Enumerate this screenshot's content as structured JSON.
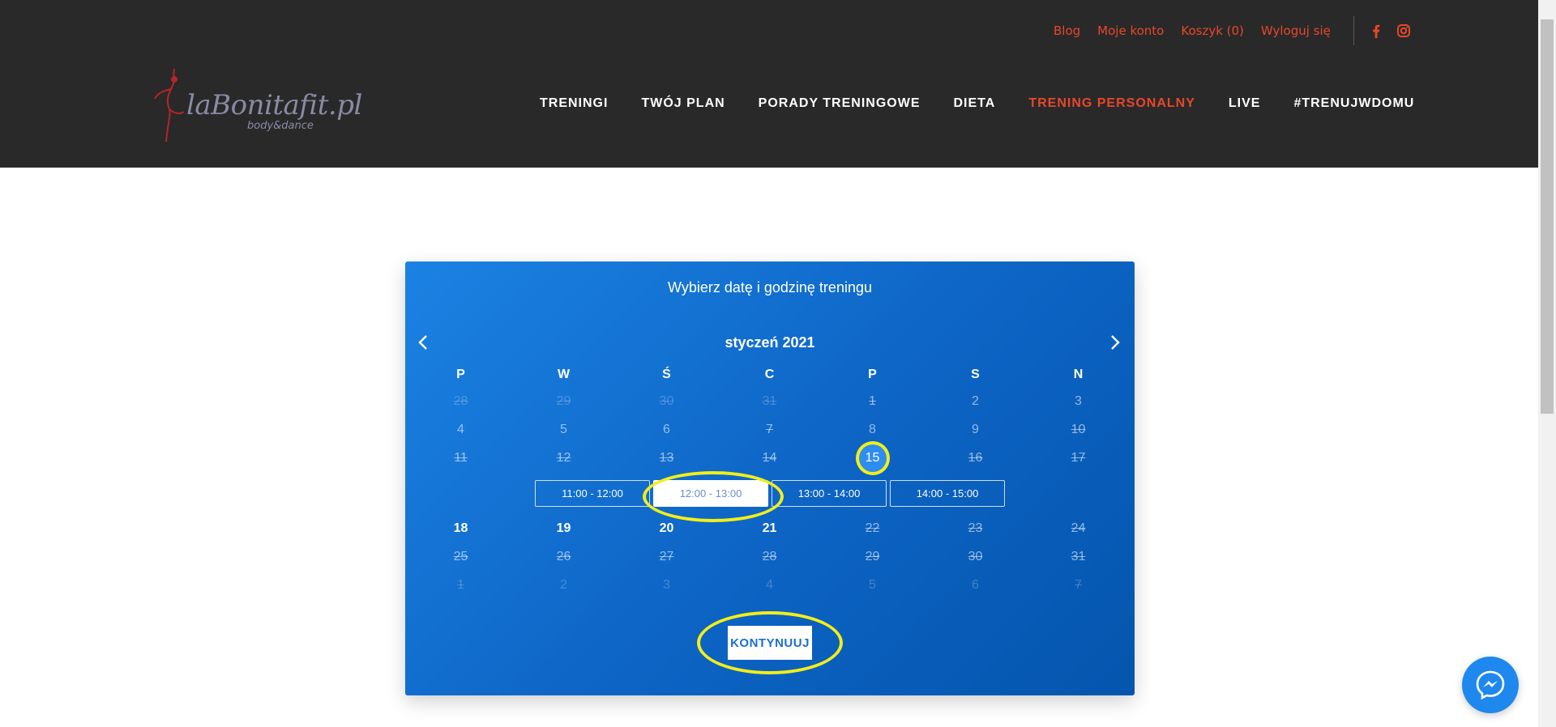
{
  "header": {
    "top_links": [
      "Blog",
      "Moje konto",
      "Koszyk (0)",
      "Wyloguj się"
    ],
    "social": [
      "facebook-icon",
      "instagram-icon"
    ],
    "logo": {
      "text": "laBonitafit.pl",
      "sub": "body&dance"
    },
    "nav": [
      {
        "label": "TRENINGI",
        "active": false
      },
      {
        "label": "TWÓJ PLAN",
        "active": false
      },
      {
        "label": "PORADY TRENINGOWE",
        "active": false
      },
      {
        "label": "DIETA",
        "active": false
      },
      {
        "label": "TRENING PERSONALNY",
        "active": true
      },
      {
        "label": "LIVE",
        "active": false
      },
      {
        "label": "#TRENUJWDOMU",
        "active": false
      }
    ],
    "accent_color": "#e8462a"
  },
  "calendar": {
    "title": "Wybierz datę i godzinę treningu",
    "month": "styczeń 2021",
    "weekdays": [
      "P",
      "W",
      "Ś",
      "C",
      "P",
      "S",
      "N"
    ],
    "weeks_before_slots": [
      [
        {
          "d": "28",
          "s": "other-strike"
        },
        {
          "d": "29",
          "s": "other-strike"
        },
        {
          "d": "30",
          "s": "other-strike"
        },
        {
          "d": "31",
          "s": "other-strike"
        },
        {
          "d": "1",
          "s": "strike"
        },
        {
          "d": "2",
          "s": "dim"
        },
        {
          "d": "3",
          "s": "dim"
        }
      ],
      [
        {
          "d": "4",
          "s": "dim"
        },
        {
          "d": "5",
          "s": "dim"
        },
        {
          "d": "6",
          "s": "dim"
        },
        {
          "d": "7",
          "s": "strike"
        },
        {
          "d": "8",
          "s": "dim"
        },
        {
          "d": "9",
          "s": "dim"
        },
        {
          "d": "10",
          "s": "strike"
        }
      ],
      [
        {
          "d": "11",
          "s": "strike"
        },
        {
          "d": "12",
          "s": "strike"
        },
        {
          "d": "13",
          "s": "strike"
        },
        {
          "d": "14",
          "s": "strike"
        },
        {
          "d": "15",
          "s": "selected"
        },
        {
          "d": "16",
          "s": "strike"
        },
        {
          "d": "17",
          "s": "strike"
        }
      ]
    ],
    "slots": [
      {
        "label": "11:00 - 12:00",
        "active": false
      },
      {
        "label": "12:00 - 13:00",
        "active": true
      },
      {
        "label": "13:00 - 14:00",
        "active": false
      },
      {
        "label": "14:00 - 15:00",
        "active": false
      }
    ],
    "weeks_after_slots": [
      [
        {
          "d": "18",
          "s": "avail"
        },
        {
          "d": "19",
          "s": "avail"
        },
        {
          "d": "20",
          "s": "avail"
        },
        {
          "d": "21",
          "s": "avail"
        },
        {
          "d": "22",
          "s": "strike"
        },
        {
          "d": "23",
          "s": "strike"
        },
        {
          "d": "24",
          "s": "strike"
        }
      ],
      [
        {
          "d": "25",
          "s": "strike"
        },
        {
          "d": "26",
          "s": "strike"
        },
        {
          "d": "27",
          "s": "strike"
        },
        {
          "d": "28",
          "s": "strike"
        },
        {
          "d": "29",
          "s": "strike"
        },
        {
          "d": "30",
          "s": "strike"
        },
        {
          "d": "31",
          "s": "strike"
        }
      ],
      [
        {
          "d": "1",
          "s": "other-strike"
        },
        {
          "d": "2",
          "s": "other"
        },
        {
          "d": "3",
          "s": "other"
        },
        {
          "d": "4",
          "s": "other"
        },
        {
          "d": "5",
          "s": "other"
        },
        {
          "d": "6",
          "s": "other"
        },
        {
          "d": "7",
          "s": "other-strike"
        }
      ]
    ],
    "continue_label": "KONTYNUUJ",
    "highlight_color": "#f2ee1a"
  },
  "widgets": {
    "messenger": "messenger-icon"
  }
}
